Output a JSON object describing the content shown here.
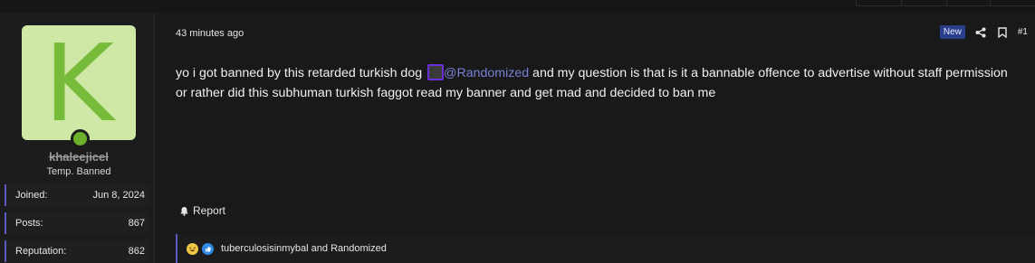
{
  "post": {
    "time": "43 minutes ago",
    "badge": "New",
    "number": "#1",
    "message_part1": "yo i got banned by this retarded turkish dog ",
    "mention": "@Randomized",
    "message_part2": " and my question is that is it a bannable offence to advertise without staff permission or rather did this subhuman turkish faggot read my banner and get mad and decided to ban me",
    "report_label": "Report",
    "reactions_text": "tuberculosisinmybal and Randomized"
  },
  "user": {
    "avatar_letter": "K",
    "username": "khaleejicel",
    "title": "Temp. Banned",
    "stats": [
      {
        "label": "Joined:",
        "value": "Jun 8, 2024"
      },
      {
        "label": "Posts:",
        "value": "867"
      },
      {
        "label": "Reputation:",
        "value": "862"
      }
    ]
  },
  "colors": {
    "accent": "#5a5ac0",
    "avatar_bg": "#cfe8a5",
    "avatar_letter": "#77bb3b",
    "online": "#6bb02b",
    "badge": "#2b3e8c",
    "mention": "#7b7fd6"
  },
  "icons": {
    "share": "share-icon",
    "bookmark": "bookmark-icon",
    "report": "bell-icon",
    "reaction1": "laugh-emoji-icon",
    "reaction2": "like-icon"
  }
}
